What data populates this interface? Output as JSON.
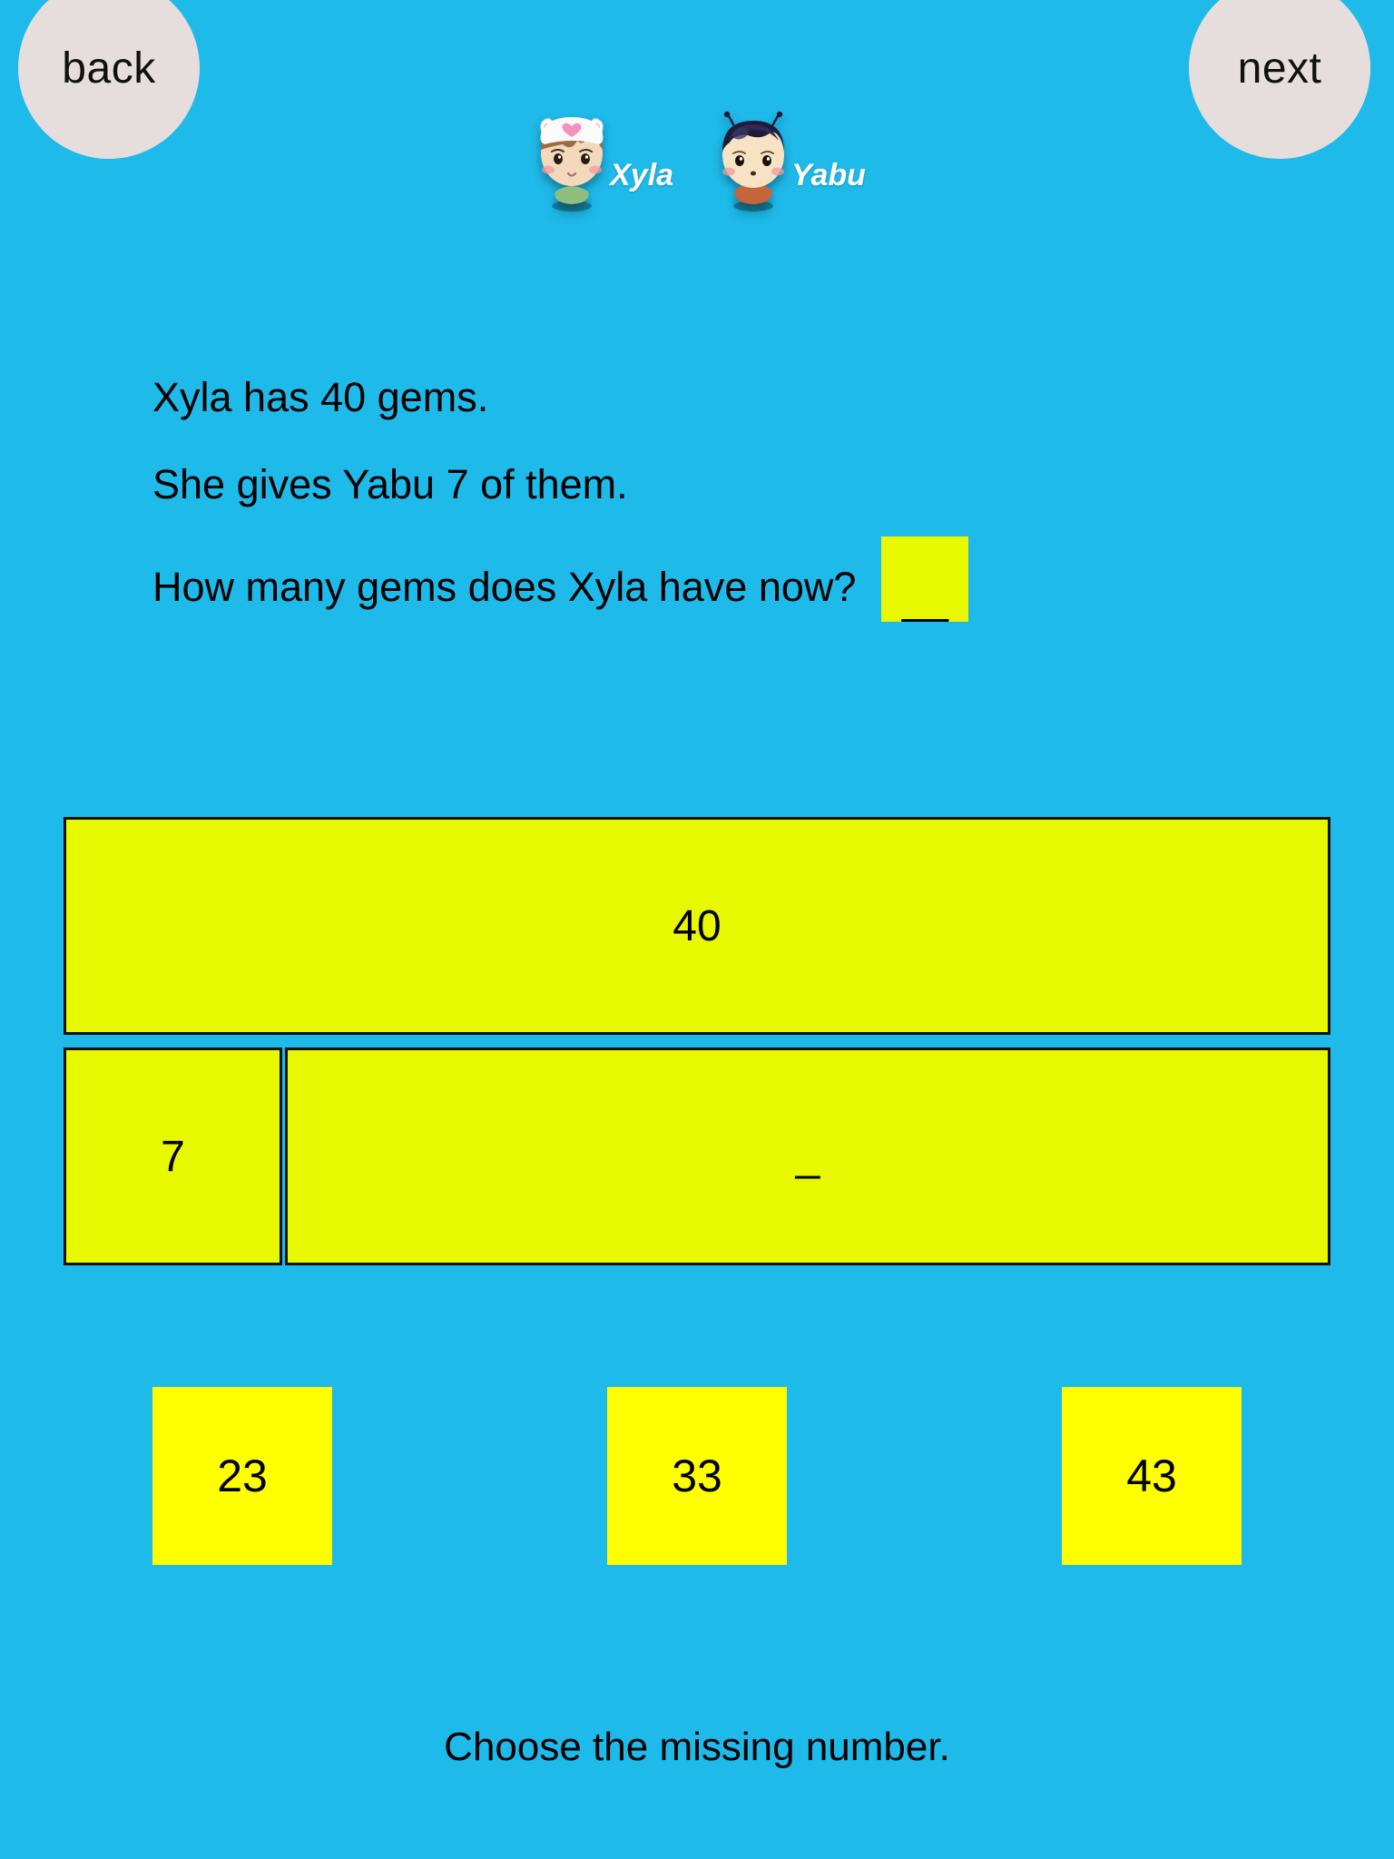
{
  "nav": {
    "back_label": "back",
    "next_label": "next"
  },
  "characters": [
    {
      "name": "Xyla",
      "icon": "girl-cat-hat-avatar-icon"
    },
    {
      "name": "Yabu",
      "icon": "boy-dark-hair-avatar-icon"
    }
  ],
  "problem": {
    "line1": "Xyla has 40 gems.",
    "line2": "She gives Yabu 7 of them.",
    "line3": "How many gems does Xyla have now?",
    "answer_box_value": "__"
  },
  "bar_model": {
    "whole_label": "40",
    "part_known_label": "7",
    "part_unknown_label": "_"
  },
  "choices": [
    {
      "label": "23"
    },
    {
      "label": "33"
    },
    {
      "label": "43"
    }
  ],
  "prompt": {
    "text": "Choose the missing number."
  },
  "colors": {
    "background": "#1EBAEA",
    "bar_fill": "#E8F800",
    "choice_fill": "#FFFF00",
    "nav_circle": "#E6DEDC",
    "text": "#000000",
    "name_text": "#FFFFFF"
  }
}
